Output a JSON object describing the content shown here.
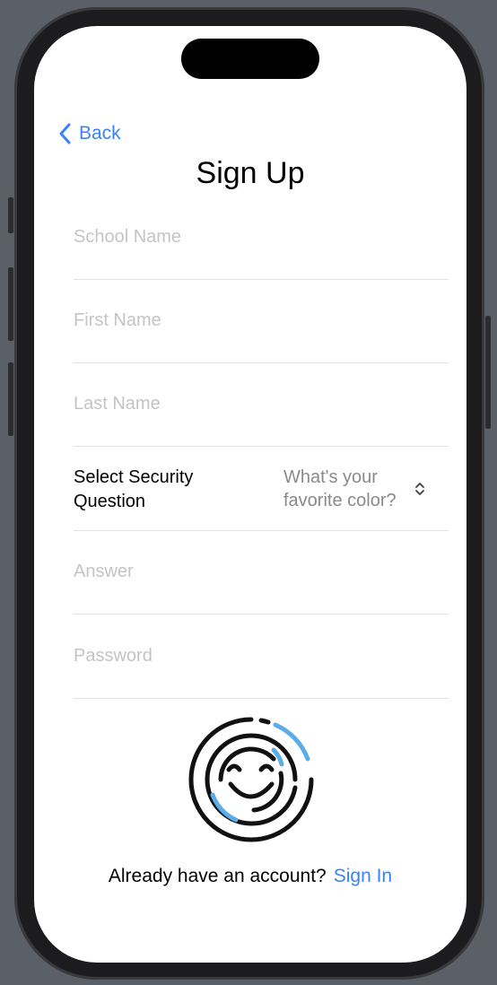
{
  "nav": {
    "back_label": "Back"
  },
  "page": {
    "title": "Sign Up"
  },
  "form": {
    "school_name_placeholder": "School Name",
    "first_name_placeholder": "First Name",
    "last_name_placeholder": "Last Name",
    "security_question_label": "Select Security Question",
    "security_question_value": "What's your favorite color?",
    "answer_placeholder": "Answer",
    "password_placeholder": "Password"
  },
  "footer": {
    "prompt": "Already have an account?",
    "signin_label": "Sign In"
  },
  "colors": {
    "accent": "#3a82f7",
    "logo_accent": "#5aade8",
    "logo_primary": "#111111"
  },
  "icons": {
    "back": "chevron-left-icon",
    "picker": "chevron-up-down-icon",
    "logo": "smiley-fingerprint-logo"
  }
}
